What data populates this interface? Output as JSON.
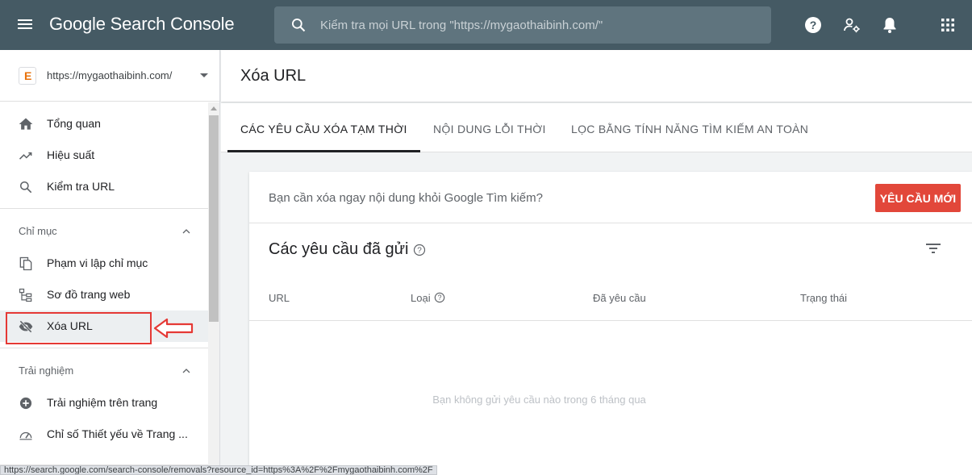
{
  "header": {
    "logo_text": "Google Search Console",
    "search_placeholder": "Kiểm tra mọi URL trong \"https://mygaothaibinh.com/\"",
    "icons": [
      "menu-icon",
      "search-icon",
      "help-icon",
      "manage-users-icon",
      "notifications-icon",
      "apps-icon"
    ]
  },
  "sidebar": {
    "property": {
      "favicon_letter": "E",
      "url": "https://mygaothaibinh.com/"
    },
    "items": [
      {
        "label": "Tổng quan",
        "icon": "home-icon"
      },
      {
        "label": "Hiệu suất",
        "icon": "trending-up-icon"
      },
      {
        "label": "Kiểm tra URL",
        "icon": "search-icon"
      }
    ],
    "section_index": {
      "title": "Chỉ mục",
      "items": [
        {
          "label": "Phạm vi lập chỉ mục",
          "icon": "copy-icon"
        },
        {
          "label": "Sơ đồ trang web",
          "icon": "sitemap-icon"
        },
        {
          "label": "Xóa URL",
          "icon": "visibility-off-icon",
          "active": true
        }
      ]
    },
    "section_experience": {
      "title": "Trải nghiệm",
      "items": [
        {
          "label": "Trải nghiệm trên trang",
          "icon": "add-circle-icon"
        },
        {
          "label": "Chỉ số Thiết yếu về Trang ...",
          "icon": "speed-icon"
        }
      ]
    }
  },
  "main": {
    "title": "Xóa URL",
    "tabs": [
      {
        "label": "CÁC YÊU CẦU XÓA TẠM THỜI",
        "active": true
      },
      {
        "label": "NỘI DUNG LỖI THỜI"
      },
      {
        "label": "LỌC BẰNG TÍNH NĂNG TÌM KIẾM AN TOÀN"
      }
    ],
    "card": {
      "question": "Bạn cần xóa ngay nội dung khỏi Google Tìm kiếm?",
      "new_request_button": "YÊU CẦU MỚI",
      "sent_title": "Các yêu cầu đã gửi",
      "columns": [
        "URL",
        "Loại",
        "Đã yêu cầu",
        "Trạng thái"
      ],
      "empty_message": "Bạn không gửi yêu cầu nào trong 6 tháng qua"
    }
  },
  "statusbar": {
    "url": "https://search.google.com/search-console/removals?resource_id=https%3A%2F%2Fmygaothaibinh.com%2F"
  },
  "colors": {
    "header_bg": "#455a64",
    "accent_red": "#e2473a",
    "annotation_red": "#e53935"
  }
}
